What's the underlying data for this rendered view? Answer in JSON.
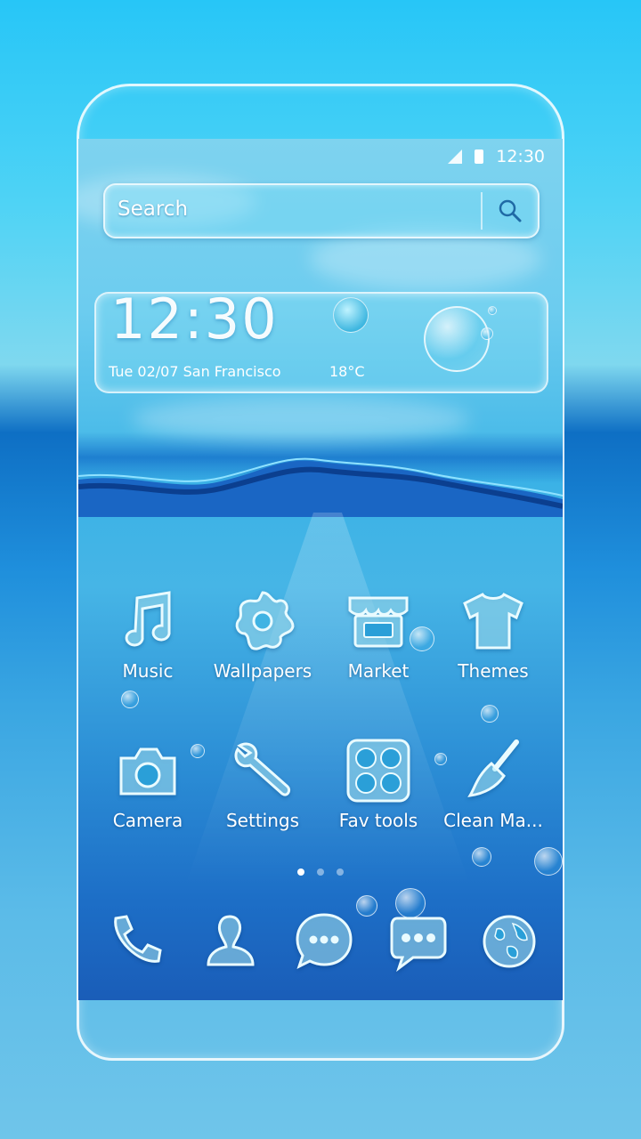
{
  "status_bar": {
    "time": "12:30"
  },
  "search": {
    "placeholder": "Search"
  },
  "clock_widget": {
    "time": "12:30",
    "date": "Tue  02/07  San Francisco",
    "temperature": "18°C"
  },
  "apps_row1": [
    {
      "label": "Music",
      "icon": "music-note-icon"
    },
    {
      "label": "Wallpapers",
      "icon": "flower-gear-icon"
    },
    {
      "label": "Market",
      "icon": "store-icon"
    },
    {
      "label": "Themes",
      "icon": "tshirt-icon"
    }
  ],
  "apps_row2": [
    {
      "label": "Camera",
      "icon": "camera-icon"
    },
    {
      "label": "Settings",
      "icon": "wrench-icon"
    },
    {
      "label": "Fav tools",
      "icon": "tools-grid-icon"
    },
    {
      "label": "Clean Ma...",
      "icon": "broom-icon"
    }
  ],
  "page_indicator": {
    "pages": 3,
    "current": 1
  },
  "dock": [
    {
      "icon": "phone-icon"
    },
    {
      "icon": "contacts-icon"
    },
    {
      "icon": "messages-icon"
    },
    {
      "icon": "chat-icon"
    },
    {
      "icon": "browser-globe-icon"
    }
  ],
  "colors": {
    "accent": "#5ccbf0",
    "deep_water": "#1a5db8",
    "glass_white": "#e9fbff"
  }
}
